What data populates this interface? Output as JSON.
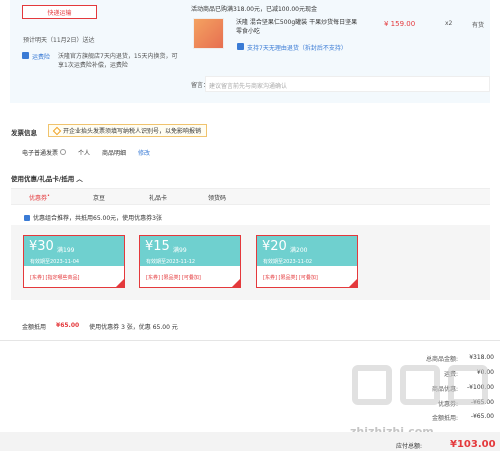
{
  "order": {
    "shipping_button": "快递运输",
    "eta": "预计明天（11月2日）送达",
    "tag_label": "运费险",
    "promise": "沃隆官方旗舰店7天内退货，15天内换货，可享1次运费险补偿，运费险",
    "promo_line": "活动商品已购满318.00元，已减100.00元现金",
    "goods_name": "沃隆 混合坚果仁500g罐装 干果炒货每日坚果 零食小吃",
    "goods_price": "¥ 159.00",
    "goods_qty": "x2",
    "goods_stock": "有货",
    "return_note": "支持7天无理由退货（拆封后不支持）",
    "remark_label": "留言：",
    "remark_placeholder": "建议留言前先与商家沟通确认"
  },
  "invoice": {
    "title": "发票信息",
    "tip": "开企业抬头发票须填写纳税人识别号，以免影响报销",
    "type": "电子普通发票",
    "holder": "个人",
    "content": "商品明细",
    "edit": "修改"
  },
  "coupons": {
    "title": "使用优惠/礼品卡/抵用",
    "arrow": "︿",
    "tabs": [
      {
        "label": "优惠券",
        "active": true,
        "sup": "•"
      },
      {
        "label": "京豆",
        "active": false
      },
      {
        "label": "礼品卡",
        "active": false
      },
      {
        "label": "领货码",
        "active": false
      }
    ],
    "option": "优惠组合推荐，共抵用65.00元，使用优惠券3张",
    "items": [
      {
        "amount": "¥30",
        "cond": "满199",
        "valid": "有效期至2023-11-04",
        "tags": "[东券] [指定哪些商品]"
      },
      {
        "amount": "¥15",
        "cond": "满99",
        "valid": "有效期至2023-11-12",
        "tags": "[东券] [限品类] [可叠加]"
      },
      {
        "amount": "¥20",
        "cond": "满200",
        "valid": "有效期至2023-11-02",
        "tags": "[东券] [限品类] [可叠加]"
      }
    ],
    "deduct_label": "金额抵用",
    "deduct_amount": "¥65.00",
    "deduct_detail": "使用优惠券 3 张，优惠 65.00 元"
  },
  "summary": {
    "rows": [
      {
        "label": "总商品金额:",
        "value": "¥318.00"
      },
      {
        "label": "运费:",
        "value": "¥0.00"
      },
      {
        "label": "商品优惠:",
        "value": "-¥100.00"
      },
      {
        "label": "优惠券:",
        "value": "-¥65.00"
      },
      {
        "label": "金额抵用:",
        "value": "-¥65.00"
      }
    ],
    "pay_label": "应付总额:",
    "pay_value": "¥103.00"
  },
  "watermark": "zhizhizhi.com",
  "colors": {
    "accent": "#e4393c",
    "link": "#3a7bd5",
    "coupon_bg": "#6fd0cf"
  }
}
